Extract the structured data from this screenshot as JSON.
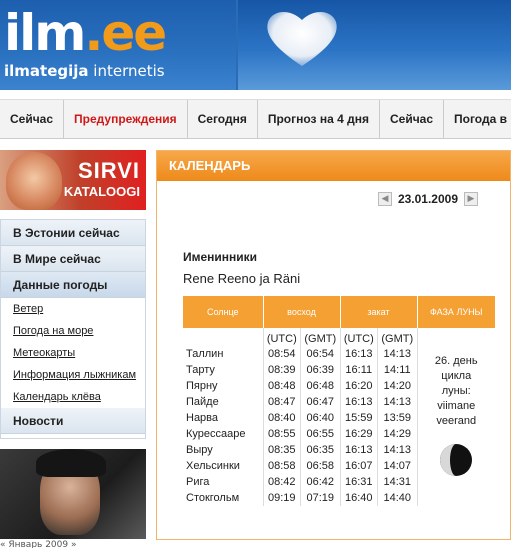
{
  "header": {
    "logo_main": "ilm",
    "logo_dot": ".",
    "logo_ee": "ee",
    "logo_sub_bold": "ilmategija",
    "logo_sub_rest": " internetis"
  },
  "nav": {
    "items": [
      {
        "label": "Сейчас",
        "active": false
      },
      {
        "label": "Предупреждения",
        "active": true
      },
      {
        "label": "Сегодня",
        "active": false
      },
      {
        "label": "Прогноз на 4 дня",
        "active": false
      },
      {
        "label": "Сейчас",
        "active": false
      },
      {
        "label": "Погода в м",
        "active": false
      }
    ]
  },
  "banner1": {
    "line1": "SIRVI",
    "line2": "KATALOOGI"
  },
  "sidemenu": {
    "head1": "В Эстонии сейчас",
    "head2": "В Мире сейчас",
    "head3": "Данные погоды",
    "links": [
      "Ветер",
      "Погода на море",
      "Метеокарты",
      "Информация лыжникам",
      "Календарь клёва"
    ],
    "head4": "Новости"
  },
  "bottom_calendar": "«    Январь 2009    »",
  "main": {
    "title": "КАЛЕНДАРЬ",
    "date": "23.01.2009",
    "prev_icon": "arrow-left-icon",
    "next_icon": "arrow-right-icon",
    "names_title": "Именинники",
    "names_value": "Rene Reeno ja Räni",
    "table": {
      "headers": [
        "Солнце",
        "восход",
        "закат",
        "ФАЗА ЛУНЫ"
      ],
      "units": [
        "(UTC)",
        "(GMT)",
        "(UTC)",
        "(GMT)"
      ],
      "rows": [
        {
          "city": "Таллин",
          "rise_utc": "08:54",
          "rise_gmt": "06:54",
          "set_utc": "16:13",
          "set_gmt": "14:13"
        },
        {
          "city": "Тарту",
          "rise_utc": "08:39",
          "rise_gmt": "06:39",
          "set_utc": "16:11",
          "set_gmt": "14:11"
        },
        {
          "city": "Пярну",
          "rise_utc": "08:48",
          "rise_gmt": "06:48",
          "set_utc": "16:20",
          "set_gmt": "14:20"
        },
        {
          "city": "Пайде",
          "rise_utc": "08:47",
          "rise_gmt": "06:47",
          "set_utc": "16:13",
          "set_gmt": "14:13"
        },
        {
          "city": "Нарва",
          "rise_utc": "08:40",
          "rise_gmt": "06:40",
          "set_utc": "15:59",
          "set_gmt": "13:59"
        },
        {
          "city": "Курессааре",
          "rise_utc": "08:55",
          "rise_gmt": "06:55",
          "set_utc": "16:29",
          "set_gmt": "14:29"
        },
        {
          "city": "Выру",
          "rise_utc": "08:35",
          "rise_gmt": "06:35",
          "set_utc": "16:13",
          "set_gmt": "14:13"
        },
        {
          "city": "Хельсинки",
          "rise_utc": "08:58",
          "rise_gmt": "06:58",
          "set_utc": "16:07",
          "set_gmt": "14:07"
        },
        {
          "city": "Рига",
          "rise_utc": "08:42",
          "rise_gmt": "06:42",
          "set_utc": "16:31",
          "set_gmt": "14:31"
        },
        {
          "city": "Стокгольм",
          "rise_utc": "09:19",
          "rise_gmt": "07:19",
          "set_utc": "16:40",
          "set_gmt": "14:40"
        }
      ],
      "moon_text": [
        "26. день цикла",
        "луны:",
        "viimane",
        "veerand"
      ]
    }
  },
  "colors": {
    "orange": "#f5a033",
    "nav_active": "#d01818",
    "header_blue": "#2a6db5"
  }
}
